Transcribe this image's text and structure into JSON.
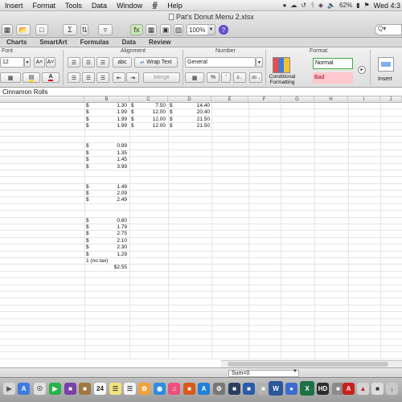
{
  "menubar": {
    "items": [
      "Insert",
      "Format",
      "Tools",
      "Data",
      "Window",
      "Help"
    ],
    "battery": "62%",
    "clock": "Wed 4:3"
  },
  "window": {
    "title": "Pat's Donut Menu 2.xlsx",
    "zoom": "100%"
  },
  "ribbon": {
    "tabs": [
      "Charts",
      "SmartArt",
      "Formulas",
      "Data",
      "Review"
    ],
    "groups": {
      "font": "Font",
      "alignment": "Alignment",
      "number": "Number",
      "format": "Format"
    },
    "font_size": "12",
    "wrap_text": "Wrap Text",
    "merge": "Merge",
    "number_format": "General",
    "abc_label": "abc",
    "conditional_formatting": [
      "Conditional",
      "Formatting"
    ],
    "style_normal": "Normal",
    "style_bad": "Bad",
    "insert_label": "Insert"
  },
  "formula_bar": {
    "content": "Cinnamon Rolls"
  },
  "columns": [
    "B",
    "C",
    "D",
    "E",
    "F",
    "G",
    "H",
    "I",
    "J"
  ],
  "rows": [
    {
      "b": "1.30",
      "c": "7.50",
      "d": "14.40"
    },
    {
      "b": "1.99",
      "c": "12.00",
      "d": "20.40"
    },
    {
      "b": "1.99",
      "c": "12.00",
      "d": "21.50"
    },
    {
      "b": "1.99",
      "c": "12.00",
      "d": "21.50"
    },
    {},
    {},
    {
      "b": "0.99"
    },
    {
      "b": "1.35"
    },
    {
      "b": "1.45"
    },
    {
      "b": "3.99"
    },
    {},
    {},
    {
      "b": "1.49"
    },
    {
      "b": "2.09"
    },
    {
      "b": "2.49"
    },
    {},
    {},
    {
      "b": "0.80"
    },
    {
      "b": "1.79"
    },
    {
      "b": "2.75"
    },
    {
      "b": "2.10"
    },
    {
      "b": "2.30"
    },
    {
      "b": "1.29"
    },
    {
      "b_text": "1 (no tax)"
    },
    {
      "b_total": "$2.55"
    }
  ],
  "currency_symbol": "$",
  "status": {
    "sum": "Sum=0"
  }
}
